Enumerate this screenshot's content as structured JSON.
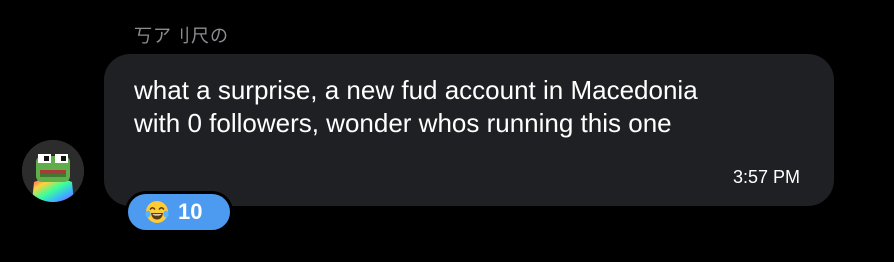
{
  "sender": {
    "name": "丂ア刂尺の"
  },
  "message": {
    "text": "what a surprise, a new fud account in Macedonia with 0 followers, wonder whos running this one",
    "time": "3:57 PM"
  },
  "avatar": {
    "icon": "pepe-frog-avatar"
  },
  "reaction": {
    "emoji": "😂",
    "icon": "laughing-tears-emoji-icon",
    "count": "10"
  },
  "colors": {
    "background": "#000000",
    "bubble": "#1f2023",
    "sender_name": "#8b8d91",
    "reaction_pill": "#4d9bf0"
  }
}
